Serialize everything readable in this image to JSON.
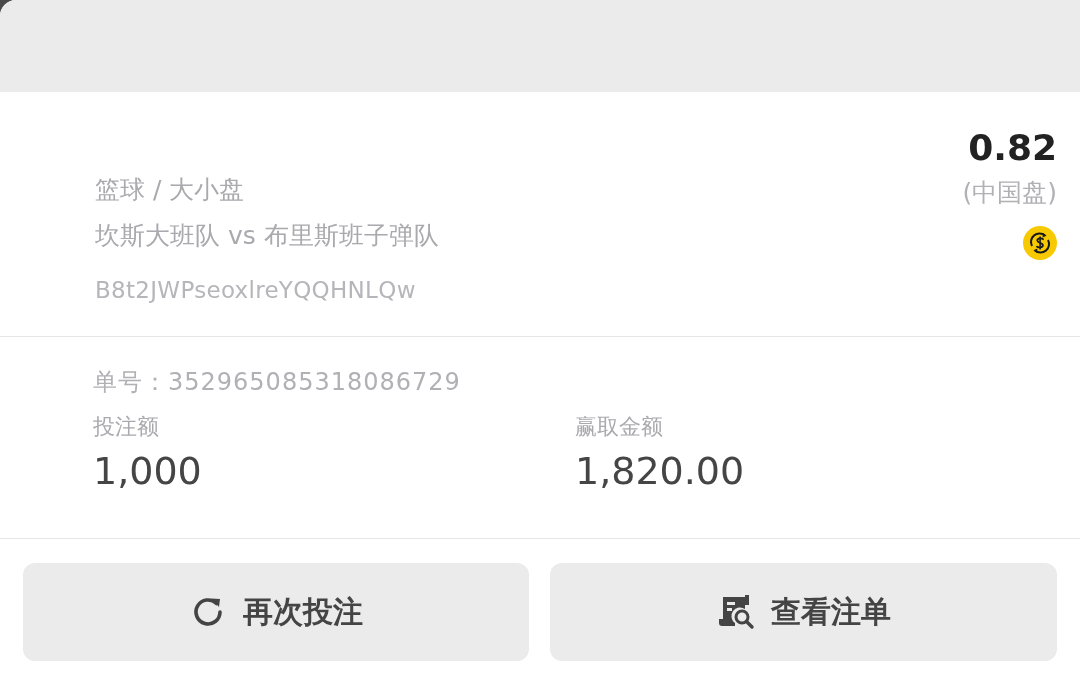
{
  "bet": {
    "sport_market": "篮球 / 大小盘",
    "match": "坎斯大班队 vs 布里斯班子弹队",
    "code": "B8t2JWPseoxlreYQQHNLQw",
    "odds": "0.82",
    "odds_type": "(中国盘)"
  },
  "order": {
    "number": "单号：352965085318086729"
  },
  "amounts": [
    {
      "label": "投注额",
      "value": "1,000"
    },
    {
      "label": "赢取金额",
      "value": "1,820.00"
    }
  ],
  "buttons": [
    {
      "kind": "rebet",
      "label": "再次投注"
    },
    {
      "kind": "view",
      "label": "查看注单"
    }
  ]
}
